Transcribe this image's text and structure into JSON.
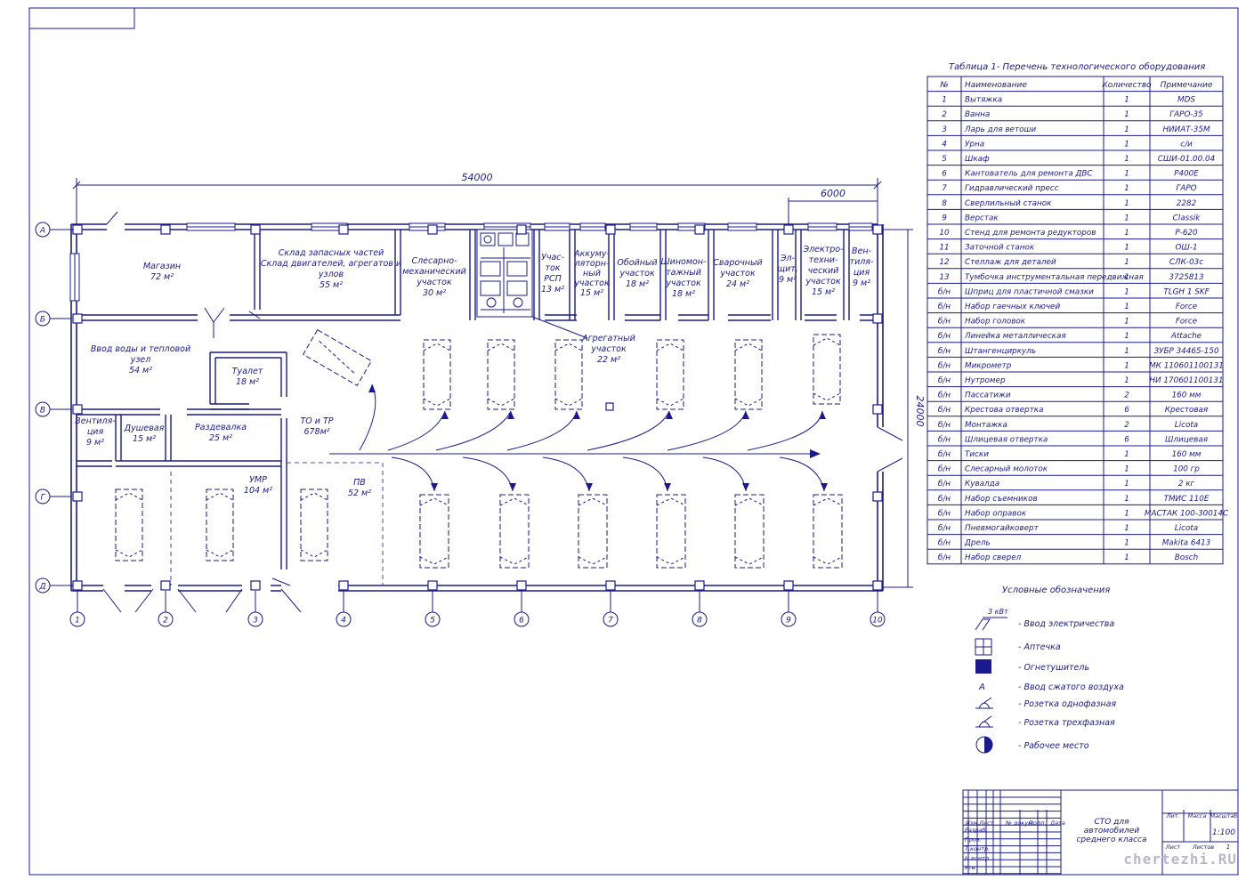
{
  "plan": {
    "dim_total_length": "54000",
    "dim_bay": "6000",
    "dim_width": "24000",
    "axis_rows": [
      "А",
      "Б",
      "В",
      "Г",
      "Д"
    ],
    "axis_cols": [
      "1",
      "2",
      "3",
      "4",
      "5",
      "6",
      "7",
      "8",
      "9",
      "10"
    ],
    "rooms": [
      {
        "lines": [
          "Магазин",
          "72 м²"
        ]
      },
      {
        "lines": [
          "Склад запасных частей",
          "Склад двигателей, агрегатов и",
          "узлов",
          "55 м²"
        ]
      },
      {
        "lines": [
          "Слесарно-",
          "механический",
          "участок",
          "30 м²"
        ]
      },
      {
        "lines": [
          "Учас-",
          "ток",
          "РСП",
          "13 м²"
        ]
      },
      {
        "lines": [
          "Аккуму-",
          "ляторн-",
          "ный",
          "участок",
          "15 м²"
        ]
      },
      {
        "lines": [
          "Обойный",
          "участок",
          "18 м²"
        ]
      },
      {
        "lines": [
          "Шиномон-",
          "тажный",
          "участок",
          "18 м²"
        ]
      },
      {
        "lines": [
          "Сварочный",
          "участок",
          "24 м²"
        ]
      },
      {
        "lines": [
          "Эл-",
          "щит,",
          "9 м²"
        ]
      },
      {
        "lines": [
          "Электро-",
          "техни-",
          "ческий",
          "участок",
          "15 м²"
        ]
      },
      {
        "lines": [
          "Вен-",
          "тиля-",
          "ция",
          "9 м²"
        ]
      },
      {
        "lines": [
          "Ввод воды и тепловой",
          "узел",
          "54 м²"
        ]
      },
      {
        "lines": [
          "Туалет",
          "18 м²"
        ]
      },
      {
        "lines": [
          "Агрегатный",
          "участок",
          "22 м²"
        ]
      },
      {
        "lines": [
          "Вентиля-",
          "ция",
          "9 м²"
        ]
      },
      {
        "lines": [
          "Душевая",
          "15 м²"
        ]
      },
      {
        "lines": [
          "Раздевалка",
          "25 м²"
        ]
      },
      {
        "lines": [
          "ТО и ТР",
          "678м²"
        ]
      },
      {
        "lines": [
          "УМР",
          "104 м²"
        ]
      },
      {
        "lines": [
          "ПВ",
          "52 м²"
        ]
      }
    ]
  },
  "table": {
    "title": "Таблица 1- Перечень технологического оборудования",
    "headers": [
      "№",
      "Наименование",
      "Количество",
      "Примечание"
    ],
    "rows": [
      [
        "1",
        "Вытяжка",
        "1",
        "MDS"
      ],
      [
        "2",
        "Ванна",
        "1",
        "ГАРО-35"
      ],
      [
        "3",
        "Ларь для ветоши",
        "1",
        "НИИАТ-35М"
      ],
      [
        "4",
        "Урна",
        "1",
        "с/и"
      ],
      [
        "5",
        "Шкаф",
        "1",
        "СШИ-01.00.04"
      ],
      [
        "6",
        "Кантователь для ремонта ДВС",
        "1",
        "Р400Е"
      ],
      [
        "7",
        "Гидравлический пресс",
        "1",
        "ГАРО"
      ],
      [
        "8",
        "Сверлильный станок",
        "1",
        "2282"
      ],
      [
        "9",
        "Верстак",
        "1",
        "Classik"
      ],
      [
        "10",
        "Стенд для ремонта редукторов",
        "1",
        "Р-620"
      ],
      [
        "11",
        "Заточной станок",
        "1",
        "ОШ-1"
      ],
      [
        "12",
        "Стеллаж для деталей",
        "1",
        "СЛК-03с"
      ],
      [
        "13",
        "Тумбочка инструментальная передвижная",
        "1",
        "3725813"
      ],
      [
        "б/н",
        "Шприц для пластичной смазки",
        "1",
        "TLGH 1 SKF"
      ],
      [
        "б/н",
        "Набор гаечных ключей",
        "1",
        "Force"
      ],
      [
        "б/н",
        "Набор головок",
        "1",
        "Force"
      ],
      [
        "б/н",
        "Линейка металлическая",
        "1",
        "Attache"
      ],
      [
        "б/н",
        "Штангенциркуль",
        "1",
        "ЗУБР 34465-150"
      ],
      [
        "б/н",
        "Микрометр",
        "1",
        "МК 110601100131"
      ],
      [
        "б/н",
        "Нутромер",
        "1",
        "НИ 170601100131"
      ],
      [
        "б/н",
        "Пассатижи",
        "2",
        "160 мм"
      ],
      [
        "б/н",
        "Крестова отвертка",
        "6",
        "Крестовая"
      ],
      [
        "б/н",
        "Монтажка",
        "2",
        "Licota"
      ],
      [
        "б/н",
        "Шлицевая отвертка",
        "6",
        "Шлицевая"
      ],
      [
        "б/н",
        "Тиски",
        "1",
        "160 мм"
      ],
      [
        "б/н",
        "Слесарный молоток",
        "1",
        "100 гр"
      ],
      [
        "б/н",
        "Кувалда",
        "1",
        "2 кг"
      ],
      [
        "б/н",
        "Набор съемников",
        "1",
        "ТМИС 110Е"
      ],
      [
        "б/н",
        "Набор оправок",
        "1",
        "МАСТАК 100-30014С"
      ],
      [
        "б/н",
        "Пневмогайковерт",
        "1",
        "Licota"
      ],
      [
        "б/н",
        "Дрель",
        "1",
        "Makita 6413"
      ],
      [
        "б/н",
        "Набор сверел",
        "1",
        "Bosch"
      ]
    ]
  },
  "legend": {
    "title": "Условные обозначения",
    "power_label": "3 кВт",
    "items": [
      {
        "icon": "power-input-icon",
        "label": "- Ввод электричества"
      },
      {
        "icon": "first-aid-icon",
        "label": "- Аптечка"
      },
      {
        "icon": "extinguisher-icon",
        "label": "- Огнетушитель"
      },
      {
        "icon": "compressed-air-icon",
        "symbol": "А",
        "label": "- Ввод сжатого воздуха"
      },
      {
        "icon": "single-phase-socket-icon",
        "label": "- Розетка однофазная"
      },
      {
        "icon": "three-phase-socket-icon",
        "label": "- Розетка трехфазная"
      },
      {
        "icon": "workplace-icon",
        "label": "- Рабочее место"
      }
    ]
  },
  "titleblock": {
    "name": [
      "СТО для",
      "автомобилей",
      "среднего класса"
    ],
    "lit": "Лит.",
    "mass": "Масса",
    "scale_label": "Масштаб",
    "scale": "1:100",
    "sheet": "Лист",
    "sheets": "Листов",
    "sheets_count": "1",
    "cols": [
      "Изм.",
      "Лист",
      "№ докум.",
      "Подп.",
      "Дата"
    ],
    "roles": [
      "Разраб.",
      "Пров.",
      "Т.контр.",
      "Н.контр.",
      "Утв."
    ]
  },
  "watermark": "chertezhi.RU",
  "colors": {
    "ink": "#1a1a8c",
    "paper": "#ffffff"
  }
}
